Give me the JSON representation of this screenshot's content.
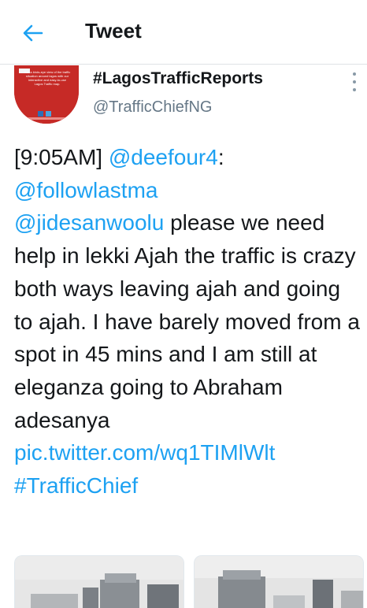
{
  "header": {
    "back_icon": "arrow-left-icon",
    "title": "Tweet"
  },
  "tweet": {
    "author": {
      "display_name": "#LagosTrafficReports",
      "handle": "@TrafficChiefNG",
      "avatar_text": "Get a birds-eye view of the traffic situation around lagos with our interactive and easy-to-use Lagos Traffic map."
    },
    "more_icon": "more-vertical-icon",
    "body": {
      "time": "[9:05AM]",
      "mention_1": "@deefour4",
      "colon": ":",
      "mention_2": "@followlastma",
      "mention_3": "@jidesanwoolu",
      "text": " please we need help in lekki Ajah the traffic is crazy both ways leaving ajah and going to ajah. I have barely moved from a spot in 45 mins and I am still at eleganza going to Abraham adesanya",
      "link": "pic.twitter.com/wq1TIMlWlt",
      "hashtag": "#TrafficChief"
    },
    "media": [
      {
        "alt": "traffic photo 1"
      },
      {
        "alt": "traffic photo 2"
      }
    ]
  },
  "colors": {
    "accent": "#1da1f2",
    "text": "#14171a",
    "secondary": "#657786",
    "avatar_bg": "#c62a26"
  }
}
